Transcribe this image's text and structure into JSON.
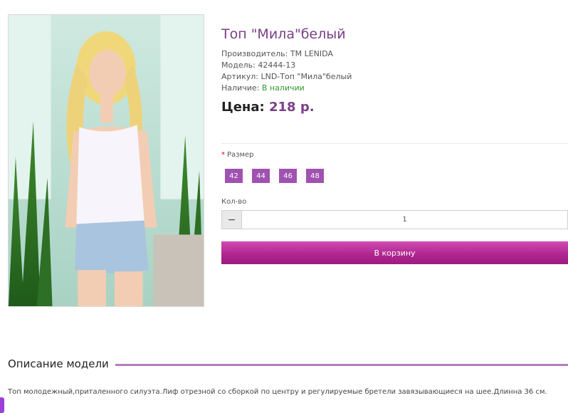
{
  "product": {
    "image_alt": "Топ \"Мила\"белый",
    "title": "Топ \"Мила\"белый",
    "manufacturer_label": "Производитель:",
    "manufacturer_value": "TM LENIDA",
    "model_label": "Модель:",
    "model_value": "42444-13",
    "sku_label": "Артикул:",
    "sku_value": "LND-Топ \"Мила\"белый",
    "availability_label": "Наличие:",
    "availability_value": "В наличии",
    "price_label": "Цена:",
    "price_value": "218 р."
  },
  "options": {
    "required_mark": "*",
    "size_label": "Размер",
    "sizes": [
      "42",
      "44",
      "46",
      "48"
    ]
  },
  "quantity": {
    "label": "Кол-во",
    "minus_symbol": "−",
    "value": "1"
  },
  "cart": {
    "button_label": "В корзину"
  },
  "description": {
    "heading": "Описание модели",
    "text": "Топ молодежный,приталенного силуэта.Лиф отрезной со сборкой по центру и регулируемые бретели завязывающиеся на шее.Длинна 36 см."
  },
  "colors": {
    "accent": "#7a3f86",
    "size_button": "#a052b0",
    "cart_button": "#b0278f",
    "in_stock": "#2e9a2e"
  }
}
